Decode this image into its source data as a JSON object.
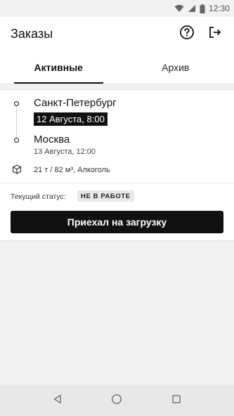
{
  "status_bar": {
    "time": "12:30",
    "icons": [
      "wifi-icon",
      "signal-icon",
      "battery-icon"
    ]
  },
  "app_bar": {
    "title": "Заказы",
    "actions": [
      "help-icon",
      "logout-icon"
    ]
  },
  "tabs": [
    {
      "label": "Активные",
      "active": true
    },
    {
      "label": "Архив",
      "active": false
    }
  ],
  "order": {
    "from": {
      "city": "Санкт-Петербург",
      "date": "12 Августа, 8:00"
    },
    "to": {
      "city": "Москва",
      "date": "13 Августа, 12:00"
    },
    "cargo": "21 т / 82 м³, Алкоголь",
    "status_label": "Текущий статус:",
    "status_value": "НЕ В РАБОТЕ",
    "action_label": "Приехал на загрузку"
  },
  "colors": {
    "primary": "#111111",
    "background": "#f2f2f2",
    "badge": "#e9e9e9"
  }
}
